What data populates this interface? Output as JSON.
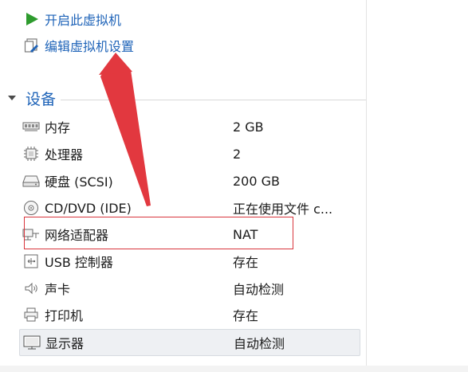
{
  "commands": {
    "start_vm": "开启此虚拟机",
    "edit_settings": "编辑虚拟机设置"
  },
  "devices_section": {
    "title": "设备"
  },
  "devices": [
    {
      "name": "内存",
      "value": "2 GB",
      "icon": "memory-icon"
    },
    {
      "name": "处理器",
      "value": "2",
      "icon": "processor-icon"
    },
    {
      "name": "硬盘 (SCSI)",
      "value": "200 GB",
      "icon": "hard-disk-icon"
    },
    {
      "name": "CD/DVD (IDE)",
      "value": "正在使用文件 c...",
      "icon": "cd-dvd-icon"
    },
    {
      "name": "网络适配器",
      "value": "NAT",
      "icon": "network-adapter-icon"
    },
    {
      "name": "USB 控制器",
      "value": "存在",
      "icon": "usb-icon"
    },
    {
      "name": "声卡",
      "value": "自动检测",
      "icon": "sound-card-icon"
    },
    {
      "name": "打印机",
      "value": "存在",
      "icon": "printer-icon"
    },
    {
      "name": "显示器",
      "value": "自动检测",
      "icon": "display-icon"
    }
  ],
  "colors": {
    "link_blue": "#1e63b8",
    "play_green": "#2e9b2e",
    "annotation_red": "#d9363e",
    "selected_bg": "#eef0f3"
  },
  "selected_device_index": 8,
  "annotation": {
    "highlighted_device_index": 4,
    "arrow_points_to": "edit_settings"
  }
}
